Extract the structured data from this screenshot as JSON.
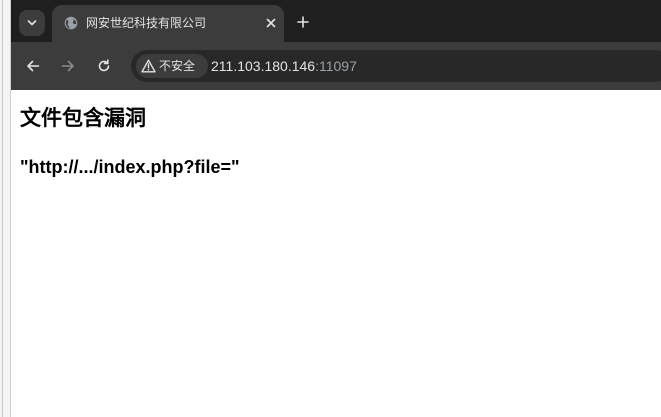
{
  "browser": {
    "tab": {
      "title": "网安世纪科技有限公司",
      "favicon_icon": "globe-icon"
    },
    "toolbar": {
      "security_label": "不安全",
      "security_icon": "warning-triangle-icon",
      "url_host": "211.103.180.146",
      "url_port": ":11097"
    }
  },
  "page": {
    "heading": "文件包含漏洞",
    "url_hint": "\"http://.../index.php?file=\""
  },
  "colors": {
    "tabstrip_bg": "#1f1f1f",
    "toolbar_bg": "#3c3c3c",
    "omnibox_bg": "#282828",
    "text_light": "#e3e3e3"
  }
}
